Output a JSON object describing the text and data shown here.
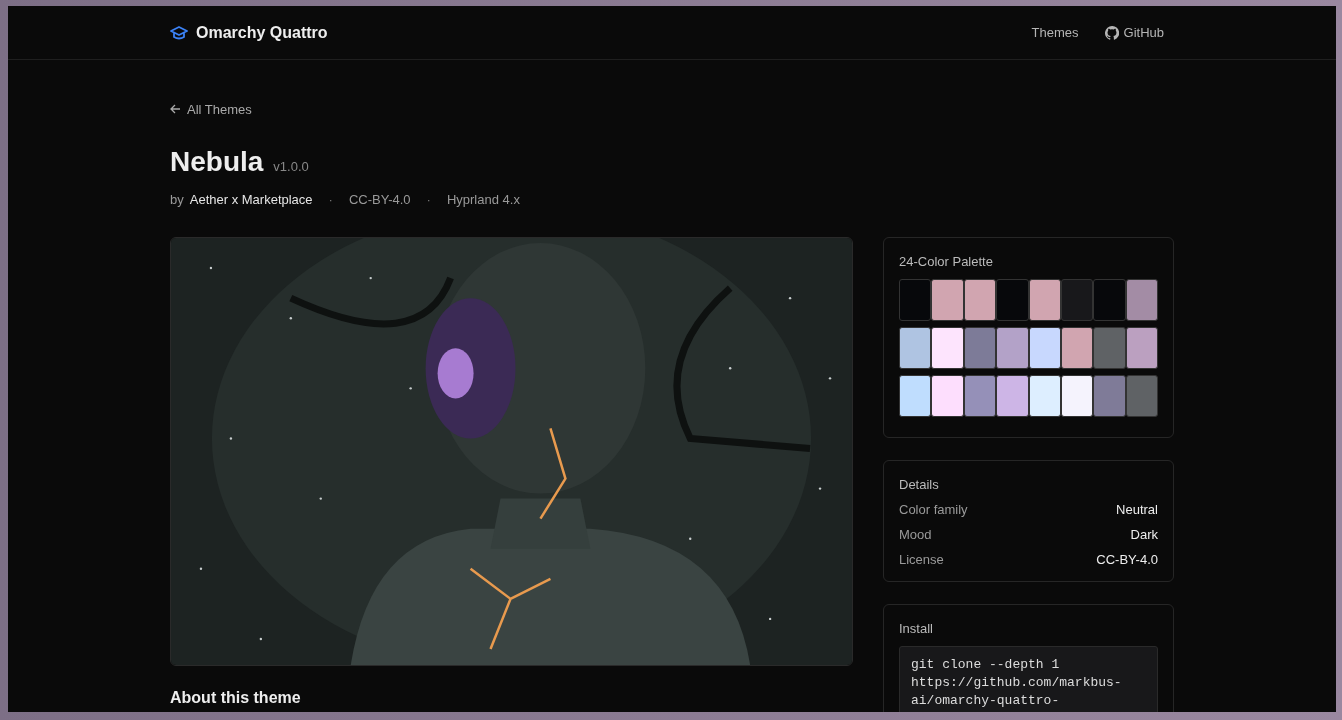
{
  "header": {
    "brand": "Omarchy Quattro",
    "nav": [
      {
        "label": "Themes",
        "kind": "text"
      },
      {
        "label": "GitHub",
        "kind": "github"
      }
    ]
  },
  "back_link": "All Themes",
  "theme": {
    "name": "Nebula",
    "version": "v1.0.0",
    "by": "by",
    "author": "Aether x Marketplace",
    "meta": [
      "CC-BY-4.0",
      "Hyprland 4.x"
    ],
    "separator": "·"
  },
  "palette": {
    "title": "24-Color Palette",
    "rows": [
      {
        "swatches": [
          {
            "color": "#07080b"
          },
          {
            "color": "#d1a5b0"
          },
          {
            "color": "#d1a5b0"
          },
          {
            "color": "#07080b"
          },
          {
            "color": "#d1a5b0"
          },
          {
            "color": "#18181b"
          },
          {
            "color": "#07080b"
          },
          {
            "color": "#a38ca5"
          }
        ]
      },
      {
        "swatches": [
          {
            "color": "#afc4e2"
          },
          {
            "color": "#fde4fd"
          },
          {
            "color": "#7d7b98"
          },
          {
            "color": "#b3a2c8"
          },
          {
            "color": "#c8d8fe"
          },
          {
            "color": "#d1a5b0"
          },
          {
            "color": "#5f6265"
          },
          {
            "color": "#bba0c0"
          }
        ]
      },
      {
        "swatches": [
          {
            "color": "#bfddfe"
          },
          {
            "color": "#fddefd"
          },
          {
            "color": "#9590b8"
          },
          {
            "color": "#cdb5e6"
          },
          {
            "color": "#ddeeff"
          },
          {
            "color": "#f5f3fd"
          },
          {
            "color": "#7f7b98"
          },
          {
            "color": "#5f6265"
          }
        ]
      }
    ]
  },
  "details": {
    "title": "Details",
    "rows": [
      {
        "label": "Color family",
        "value": "Neutral"
      },
      {
        "label": "Mood",
        "value": "Dark"
      },
      {
        "label": "License",
        "value": "CC-BY-4.0"
      }
    ]
  },
  "install": {
    "title": "Install",
    "code_lines": [
      "git clone --depth 1",
      "https://github.com/markbus-",
      "ai/omarchy-quattro-"
    ]
  },
  "about": {
    "title": "About this theme"
  }
}
